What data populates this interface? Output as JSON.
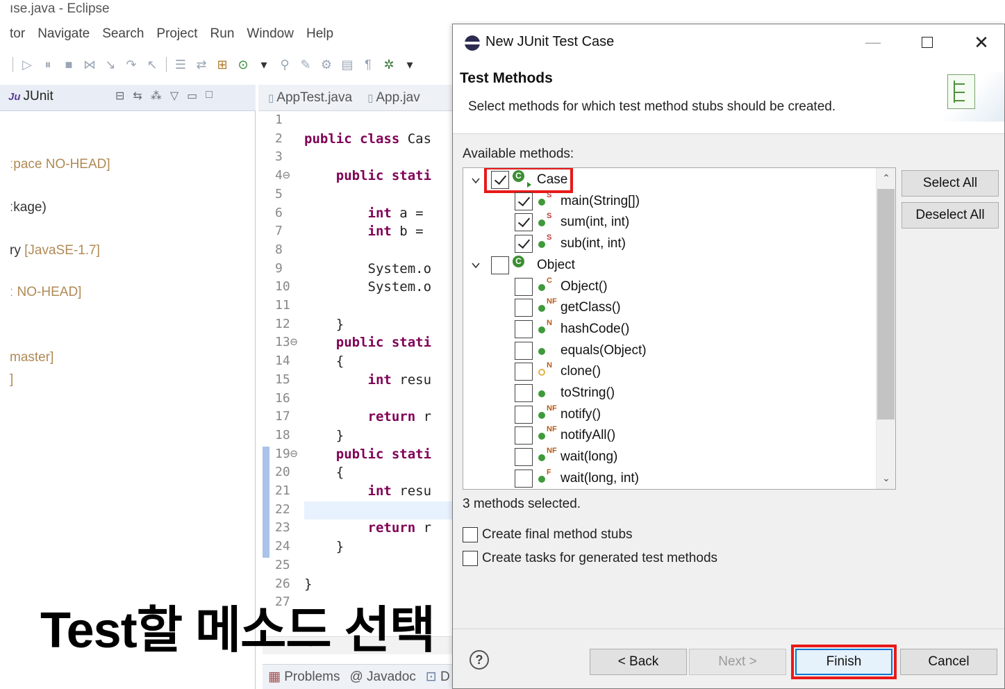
{
  "eclipse": {
    "window_title": "ıse.java - Eclipse",
    "menu": [
      "tor",
      "Navigate",
      "Search",
      "Project",
      "Run",
      "Window",
      "Help"
    ],
    "left_panel": {
      "tab_label": "JUnit",
      "lines": [
        {
          "text": "ːpace NO-HEAD]",
          "dim": true
        },
        {
          "text": "ːkage)",
          "dim": false
        },
        {
          "text": "ry ",
          "dim": false,
          "suffix": "[JavaSE-1.7]"
        },
        {
          "text": "ː NO-HEAD]",
          "dim": true
        },
        {
          "text": "master]",
          "dim": true
        },
        {
          "text": "]",
          "dim": true
        }
      ]
    },
    "editor": {
      "tabs": [
        "AppTest.java",
        "App.jav"
      ],
      "line_numbers": [
        "1",
        "2",
        "3",
        "4⊖",
        "5",
        "6",
        "7",
        "8",
        "9",
        "10",
        "11",
        "12",
        "13⊖",
        "14",
        "15",
        "16",
        "17",
        "18",
        "19⊖",
        "20",
        "21",
        "22",
        "23",
        "24",
        "25",
        "26",
        "27"
      ],
      "code": [
        {
          "line": 2,
          "kw": "public class",
          "rest": " Cas"
        },
        {
          "line": 4,
          "kw": "    public stati",
          "rest": ""
        },
        {
          "line": 6,
          "kw": "        int",
          "rest": " a ="
        },
        {
          "line": 7,
          "kw": "        int",
          "rest": " b ="
        },
        {
          "line": 9,
          "kw": "",
          "rest": "        System.o"
        },
        {
          "line": 10,
          "kw": "",
          "rest": "        System.o"
        },
        {
          "line": 12,
          "kw": "",
          "rest": "    }"
        },
        {
          "line": 13,
          "kw": "    public stati",
          "rest": ""
        },
        {
          "line": 14,
          "kw": "",
          "rest": "    {"
        },
        {
          "line": 15,
          "kw": "        int",
          "rest": " resu"
        },
        {
          "line": 17,
          "kw": "        return",
          "rest": " r"
        },
        {
          "line": 18,
          "kw": "",
          "rest": "    }"
        },
        {
          "line": 19,
          "kw": "    public stati",
          "rest": ""
        },
        {
          "line": 20,
          "kw": "",
          "rest": "    {"
        },
        {
          "line": 21,
          "kw": "        int",
          "rest": " resu"
        },
        {
          "line": 23,
          "kw": "        return",
          "rest": " r"
        },
        {
          "line": 24,
          "kw": "",
          "rest": "    }"
        },
        {
          "line": 26,
          "kw": "",
          "rest": "}"
        }
      ]
    },
    "bottom_tabs": [
      "Problems",
      "@ Javadoc",
      "D"
    ],
    "caption": "Test할 메소드 선택"
  },
  "dialog": {
    "title": "New JUnit Test Case",
    "header_title": "Test Methods",
    "header_desc": "Select methods for which test method stubs should be created.",
    "available_label": "Available methods:",
    "tree": [
      {
        "kind": "class",
        "label": "Case",
        "checked": true,
        "highlighted": true
      },
      {
        "kind": "method",
        "label": "main(String[])",
        "checked": true,
        "mod": "S",
        "visibility": "public"
      },
      {
        "kind": "method",
        "label": "sum(int, int)",
        "checked": true,
        "mod": "S",
        "visibility": "public"
      },
      {
        "kind": "method",
        "label": "sub(int, int)",
        "checked": true,
        "mod": "S",
        "visibility": "public"
      },
      {
        "kind": "class",
        "label": "Object",
        "checked": false,
        "highlighted": false
      },
      {
        "kind": "method",
        "label": "Object()",
        "checked": false,
        "mod": "C",
        "visibility": "public"
      },
      {
        "kind": "method",
        "label": "getClass()",
        "checked": false,
        "mod": "NF",
        "visibility": "public"
      },
      {
        "kind": "method",
        "label": "hashCode()",
        "checked": false,
        "mod": "N",
        "visibility": "public"
      },
      {
        "kind": "method",
        "label": "equals(Object)",
        "checked": false,
        "mod": "",
        "visibility": "public"
      },
      {
        "kind": "method",
        "label": "clone()",
        "checked": false,
        "mod": "N",
        "visibility": "protected"
      },
      {
        "kind": "method",
        "label": "toString()",
        "checked": false,
        "mod": "",
        "visibility": "public"
      },
      {
        "kind": "method",
        "label": "notify()",
        "checked": false,
        "mod": "NF",
        "visibility": "public"
      },
      {
        "kind": "method",
        "label": "notifyAll()",
        "checked": false,
        "mod": "NF",
        "visibility": "public"
      },
      {
        "kind": "method",
        "label": "wait(long)",
        "checked": false,
        "mod": "NF",
        "visibility": "public"
      },
      {
        "kind": "method",
        "label": "wait(long, int)",
        "checked": false,
        "mod": "F",
        "visibility": "public"
      }
    ],
    "select_all": "Select All",
    "deselect_all": "Deselect All",
    "status": "3 methods selected.",
    "option_final": "Create final method stubs",
    "option_tasks": "Create tasks for generated test methods",
    "buttons": {
      "help": "?",
      "back": "< Back",
      "next": "Next >",
      "finish": "Finish",
      "cancel": "Cancel"
    },
    "highlight_color": "#e81919"
  }
}
